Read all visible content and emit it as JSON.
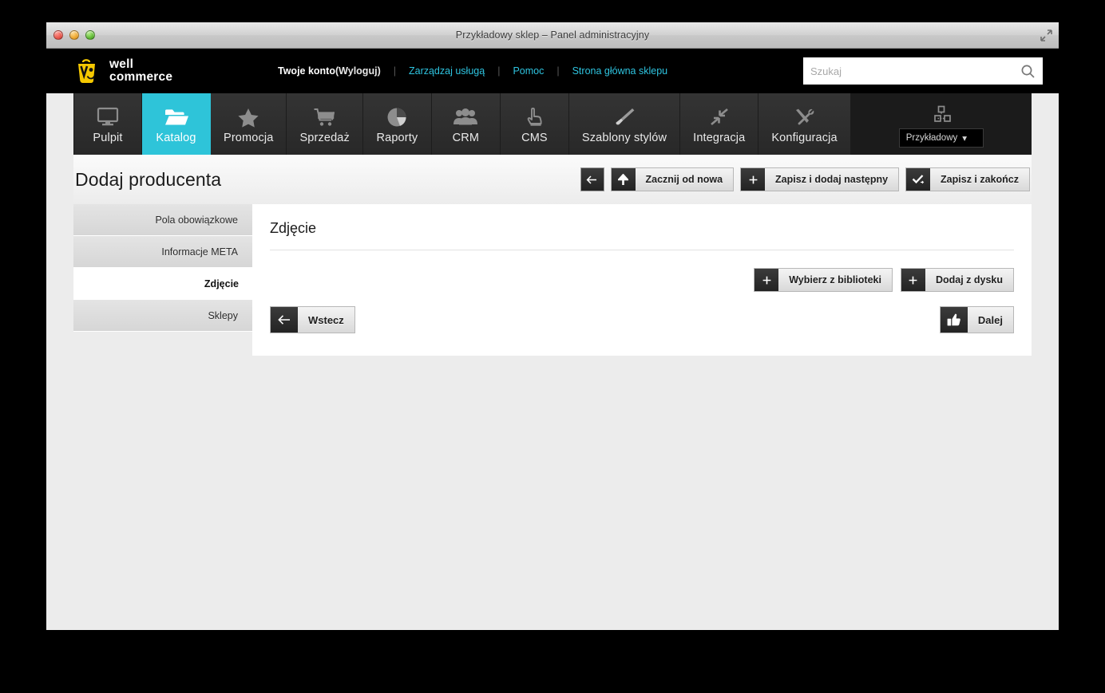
{
  "window": {
    "title": "Przykładowy sklep – Panel administracyjny",
    "traffic_lights": [
      "close-red",
      "minimize-yellow",
      "zoom-green"
    ],
    "resize_icon": "fullscreen-resize-icon"
  },
  "brand": {
    "line1": "well",
    "line2": "commerce",
    "mark": "wellcommerce-bag-logo",
    "color": "#f5c800"
  },
  "topbar": {
    "account_label": "Twoje konto",
    "logout_open": "(",
    "logout_label": "Wyloguj",
    "logout_close": ")",
    "separator": "|",
    "links": [
      {
        "label": "Zarządzaj usługą"
      },
      {
        "label": "Pomoc"
      },
      {
        "label": "Strona główna sklepu"
      }
    ],
    "search": {
      "placeholder": "Szukaj",
      "value": "",
      "icon": "search-icon"
    }
  },
  "mainnav": {
    "items": [
      {
        "label": "Pulpit",
        "icon": "monitor-icon",
        "active": false
      },
      {
        "label": "Katalog",
        "icon": "folder-open-icon",
        "active": true
      },
      {
        "label": "Promocja",
        "icon": "star-icon",
        "active": false
      },
      {
        "label": "Sprzedaż",
        "icon": "shopping-cart-icon",
        "active": false
      },
      {
        "label": "Raporty",
        "icon": "pie-chart-icon",
        "active": false
      },
      {
        "label": "CRM",
        "icon": "users-icon",
        "active": false
      },
      {
        "label": "CMS",
        "icon": "pointing-hand-icon",
        "active": false
      },
      {
        "label": "Szablony stylów",
        "icon": "paintbrush-icon",
        "active": false
      },
      {
        "label": "Integracja",
        "icon": "arrows-in-icon",
        "active": false
      },
      {
        "label": "Konfiguracja",
        "icon": "tools-icon",
        "active": false
      }
    ],
    "store_switcher": {
      "icon": "sitemap-icon",
      "label": "Przykładowy",
      "caret": "▾"
    },
    "active_color": "#2ec4d9"
  },
  "page": {
    "title": "Dodaj producenta",
    "actions": [
      {
        "name": "back",
        "label": "",
        "icon": "arrow-left-icon",
        "icon_only": true
      },
      {
        "name": "start-over",
        "label": "Zacznij od nowa",
        "icon": "arrow-up-icon",
        "icon_only": false
      },
      {
        "name": "save-and-next",
        "label": "Zapisz i dodaj następny",
        "icon": "plus-icon",
        "icon_only": false
      },
      {
        "name": "save-and-end",
        "label": "Zapisz i zakończ",
        "icon": "check-arrow-icon",
        "icon_only": false
      }
    ]
  },
  "sidebar": {
    "items": [
      {
        "label": "Pola obowiązkowe",
        "active": false
      },
      {
        "label": "Informacje META",
        "active": false
      },
      {
        "label": "Zdjęcie",
        "active": true
      },
      {
        "label": "Sklepy",
        "active": false
      }
    ]
  },
  "panel": {
    "title": "Zdjęcie",
    "upload_buttons": [
      {
        "name": "choose-from-library",
        "label": "Wybierz z biblioteki",
        "icon": "plus-icon"
      },
      {
        "name": "add-from-disk",
        "label": "Dodaj z dysku",
        "icon": "plus-icon"
      }
    ],
    "back_button": {
      "label": "Wstecz",
      "icon": "arrow-left-icon"
    },
    "next_button": {
      "label": "Dalej",
      "icon": "thumbs-up-icon"
    }
  }
}
